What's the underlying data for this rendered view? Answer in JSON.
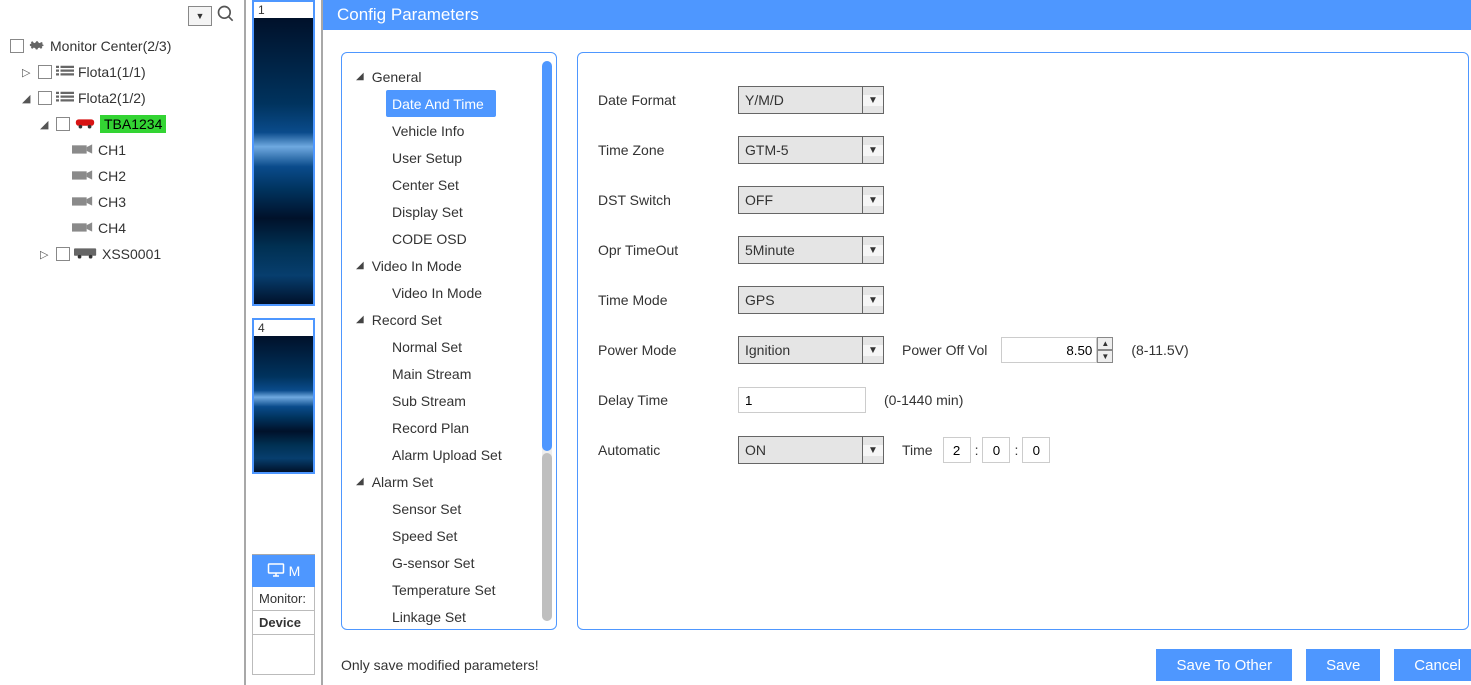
{
  "tree": {
    "root": "Monitor Center(2/3)",
    "flota1": "Flota1(1/1)",
    "flota2": "Flota2(1/2)",
    "vehicle": "TBA1234",
    "ch1": "CH1",
    "ch2": "CH2",
    "ch3": "CH3",
    "ch4": "CH4",
    "xss": "XSS0001"
  },
  "thumbs": {
    "t1": "1",
    "t4": "4"
  },
  "tabs": {
    "monitor_letter": "M",
    "monitor": "Monitor:",
    "device": "Device"
  },
  "header": {
    "title": "Config Parameters"
  },
  "nav": {
    "general": "General",
    "date_time": "Date And Time",
    "vehicle_info": "Vehicle Info",
    "user_setup": "User Setup",
    "center_set": "Center Set",
    "display_set": "Display Set",
    "code_osd": "CODE OSD",
    "video_in_mode_g": "Video In Mode",
    "video_in_mode": "Video In Mode",
    "record_set": "Record Set",
    "normal_set": "Normal Set",
    "main_stream": "Main Stream",
    "sub_stream": "Sub Stream",
    "record_plan": "Record Plan",
    "alarm_upload": "Alarm Upload Set",
    "alarm_set": "Alarm Set",
    "sensor_set": "Sensor Set",
    "speed_set": "Speed Set",
    "gsensor_set": "G-sensor Set",
    "temperature_set": "Temperature Set",
    "linkage_set": "Linkage Set"
  },
  "form": {
    "date_format_l": "Date Format",
    "date_format_v": "Y/M/D",
    "tz_l": "Time Zone",
    "tz_v": "GTM-5",
    "dst_l": "DST Switch",
    "dst_v": "OFF",
    "opr_l": "Opr TimeOut",
    "opr_v": "5Minute",
    "tm_l": "Time Mode",
    "tm_v": "GPS",
    "pm_l": "Power Mode",
    "pm_v": "Ignition",
    "pov_l": "Power Off Vol",
    "pov_v": "8.50",
    "pov_hint": "(8-11.5V)",
    "delay_l": "Delay Time",
    "delay_v": "1",
    "delay_hint": "(0-1440 min)",
    "auto_l": "Automatic",
    "auto_v": "ON",
    "time_l": "Time",
    "time_h": "2",
    "time_m": "0",
    "time_s": "0"
  },
  "bottom": {
    "note": "Only save modified parameters!",
    "save_other": "Save To Other",
    "save": "Save",
    "cancel": "Cancel"
  }
}
